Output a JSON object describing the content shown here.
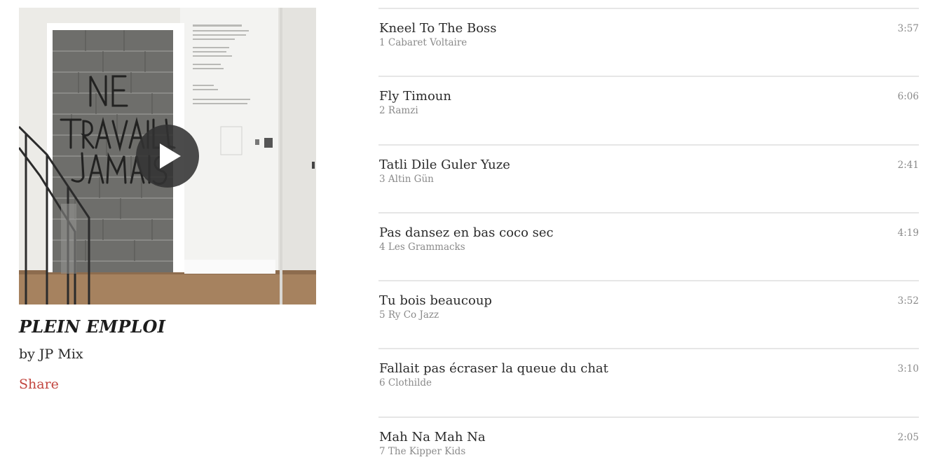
{
  "album": {
    "title": "PLEIN EMPLOI",
    "artist_line": "by JP Mix",
    "share_label": "Share",
    "cover_alt": "Album cover: graffiti 'NE TRAVAILLEZ JAMAIS' on a stone wall",
    "cover_graffiti": [
      "NE",
      "TRAVAILLEZ",
      "JAMAIS"
    ]
  },
  "tracks": [
    {
      "title": "Kneel To The Boss",
      "number": "1",
      "artist": "Cabaret Voltaire",
      "sub": "1 Cabaret Voltaire",
      "duration": "3:57"
    },
    {
      "title": "Fly Timoun",
      "number": "2",
      "artist": "Ramzi",
      "sub": "2 Ramzi",
      "duration": "6:06"
    },
    {
      "title": "Tatli Dile Guler Yuze",
      "number": "3",
      "artist": "Altin Gün",
      "sub": "3 Altin Gün",
      "duration": "2:41"
    },
    {
      "title": "Pas dansez en bas coco sec",
      "number": "4",
      "artist": "Les Grammacks",
      "sub": "4 Les Grammacks",
      "duration": "4:19"
    },
    {
      "title": "Tu bois beaucoup",
      "number": "5",
      "artist": "Ry Co Jazz",
      "sub": "5 Ry Co Jazz",
      "duration": "3:52"
    },
    {
      "title": "Fallait pas écraser la queue du chat",
      "number": "6",
      "artist": "Clothilde",
      "sub": "6 Clothilde",
      "duration": "3:10"
    },
    {
      "title": "Mah Na Mah Na",
      "number": "7",
      "artist": "The Kipper Kids",
      "sub": "7 The Kipper Kids",
      "duration": "2:05"
    }
  ],
  "colors": {
    "share_link": "#c2453e",
    "divider": "#e6e6e6",
    "muted_text": "#8a8a8a",
    "play_button_bg": "#323232"
  },
  "icons": {
    "play": "play-icon"
  }
}
